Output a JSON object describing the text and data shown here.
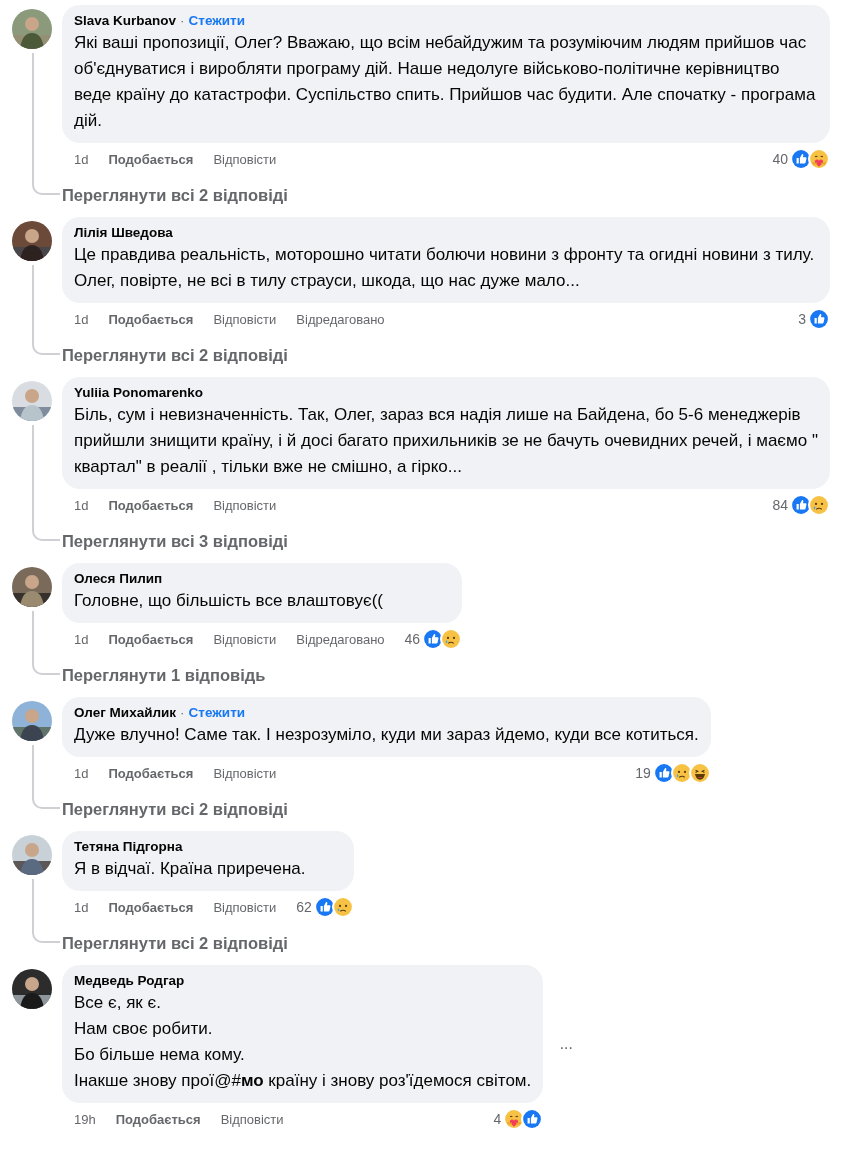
{
  "comments": [
    {
      "author": "Slava Kurbanov",
      "separator": "·",
      "follow": "Стежити",
      "text": [
        "Які ваші пропозиції, Олег? Вважаю, що всім небайдужим та розуміючим людям прийшов час об'єднуватися і виробляти програму дій. Наше недолуге військово-політичне керівництво веде країну до катастрофи. Суспільство спить. Прийшов час будити. Але спочатку - програма дій."
      ],
      "time": "1d",
      "like": "Подобається",
      "reply": "Відповісти",
      "count": "40",
      "reactions": [
        {
          "kind": "like"
        },
        {
          "kind": "care"
        }
      ],
      "replies": "Переглянути всі 2 відповіді"
    },
    {
      "author": "Лілія Шведова",
      "text": [
        "Це правдива реальність, моторошно читати болючи новини з фронту та огидні новини з тилу. Олег, повірте, не всі в тилу страуси, шкода, що нас дуже мало..."
      ],
      "time": "1d",
      "like": "Подобається",
      "reply": "Відповісти",
      "edited": "Відредаговано",
      "count": "3",
      "reactions": [
        {
          "kind": "like"
        }
      ],
      "replies": "Переглянути всі 2 відповіді"
    },
    {
      "author": "Yuliia Ponomarenko",
      "text": [
        "Біль, сум і невизначенність. Так, Олег, зараз вся надія лише на Байдена, бо 5-6 менеджерів прийшли знищити країну, і й досі багато прихильників зе не бачуть очевидних речей, і маємо \" квартал\" в реалії , тільки вже не смішно, а гірко..."
      ],
      "time": "1d",
      "like": "Подобається",
      "reply": "Відповісти",
      "count": "84",
      "reactions": [
        {
          "kind": "like"
        },
        {
          "kind": "sad"
        }
      ],
      "replies": "Переглянути всі 3 відповіді"
    },
    {
      "author": "Олеся Пилип",
      "text": [
        "Головне, що більшість все влаштовує(("
      ],
      "time": "1d",
      "like": "Подобається",
      "reply": "Відповісти",
      "edited": "Відредаговано",
      "count": "46",
      "reactions": [
        {
          "kind": "like"
        },
        {
          "kind": "sad"
        }
      ],
      "replies": "Переглянути 1 відповідь"
    },
    {
      "author": "Олег Михайлик",
      "separator": "·",
      "follow": "Стежити",
      "text": [
        "Дуже влучно! Саме так. І незрозуміло, куди ми зараз йдемо, куди все котиться."
      ],
      "time": "1d",
      "like": "Подобається",
      "reply": "Відповісти",
      "count": "19",
      "reactions": [
        {
          "kind": "like"
        },
        {
          "kind": "sad"
        },
        {
          "kind": "haha"
        }
      ],
      "replies": "Переглянути всі 2 відповіді"
    },
    {
      "author": "Тетяна Підгорна",
      "text": [
        "Я в відчаї. Країна приречена."
      ],
      "time": "1d",
      "like": "Подобається",
      "reply": "Відповісти",
      "count": "62",
      "reactions": [
        {
          "kind": "like"
        },
        {
          "kind": "sad"
        }
      ],
      "replies": "Переглянути всі 2 відповіді"
    },
    {
      "author": "Медведь Родгар",
      "text": [
        "Все є, як є.",
        "Нам своє робити.",
        "Бо більше нема кому.",
        "Інакше знову прої@#**мо** країну і знову роз'їдемося світом."
      ],
      "time": "19h",
      "like": "Подобається",
      "reply": "Відповісти",
      "count": "4",
      "reactions": [
        {
          "kind": "care"
        },
        {
          "kind": "like"
        }
      ],
      "more": "···"
    }
  ]
}
